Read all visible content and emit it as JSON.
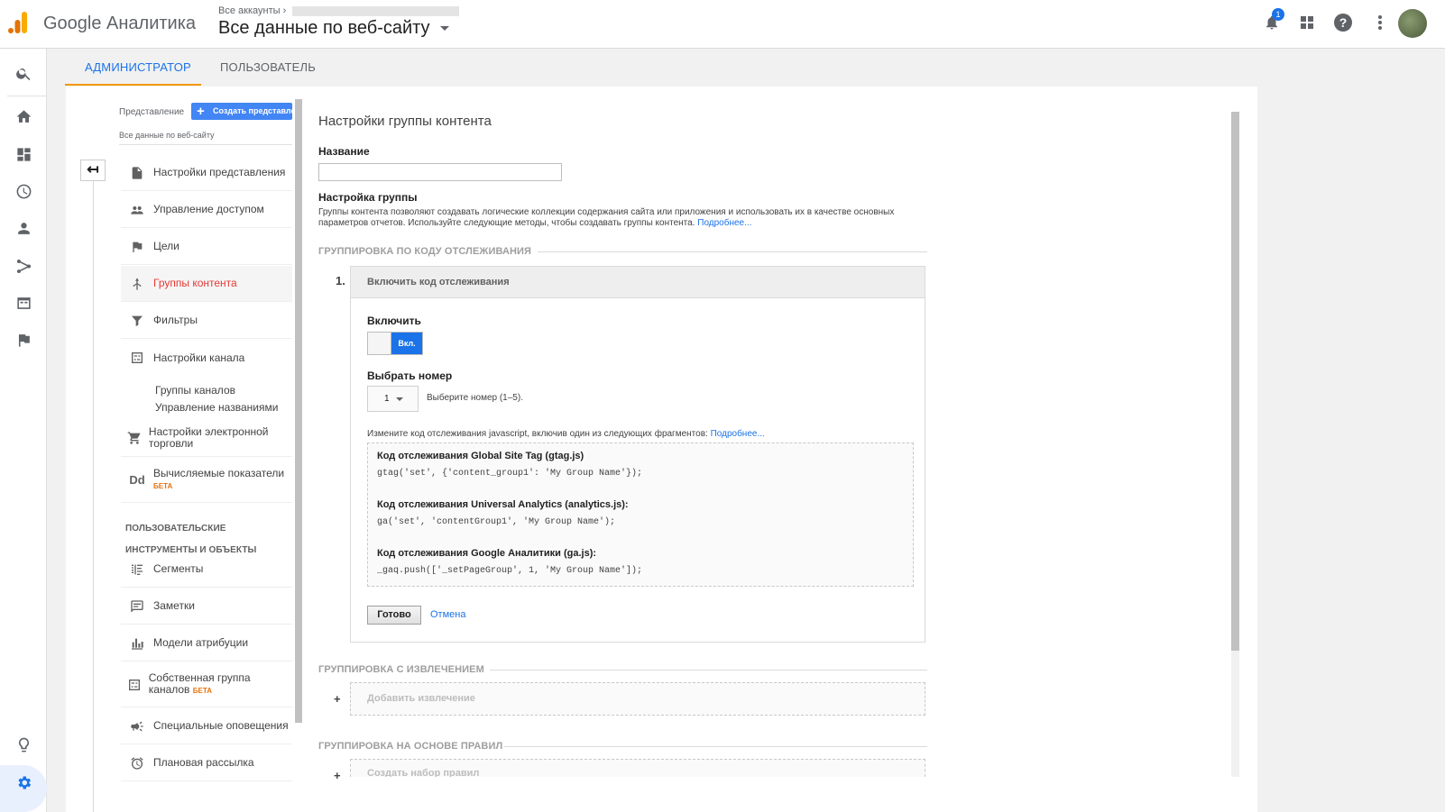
{
  "brand": {
    "name": "Google Аналитика"
  },
  "account": {
    "crumb": "Все аккаунты",
    "view": "Все данные по веб-сайту"
  },
  "notifications": {
    "count": "1"
  },
  "tabs": {
    "admin": "АДМИНИСТРАТОР",
    "user": "ПОЛЬЗОВАТЕЛЬ"
  },
  "view_column": {
    "label": "Представление",
    "create_button": "Создать представление",
    "view_name": "Все данные по веб-сайту",
    "items": [
      {
        "label": "Настройки представления",
        "icon": "document-icon"
      },
      {
        "label": "Управление доступом",
        "icon": "people-icon"
      },
      {
        "label": "Цели",
        "icon": "flag-icon"
      },
      {
        "label": "Группы контента",
        "icon": "content-group-icon"
      },
      {
        "label": "Фильтры",
        "icon": "filter-icon"
      },
      {
        "label": "Настройки канала",
        "icon": "channel-settings-icon"
      }
    ],
    "sub_items": [
      "Группы каналов",
      "Управление названиями"
    ],
    "items2": [
      {
        "label": "Настройки электронной торговли",
        "icon": "cart-icon"
      },
      {
        "label": "Вычисляемые показатели",
        "badge": "БЕТА",
        "icon": "dd-icon"
      }
    ],
    "section_title": "ПОЛЬЗОВАТЕЛЬСКИЕ ИНСТРУМЕНТЫ И ОБЪЕКТЫ",
    "items3": [
      {
        "label": "Сегменты",
        "icon": "segments-icon"
      },
      {
        "label": "Заметки",
        "icon": "notes-icon"
      },
      {
        "label": "Модели атрибуции",
        "icon": "attribution-icon"
      },
      {
        "label": "Собственная группа каналов",
        "badge": "БЕТА",
        "icon": "custom-channel-icon"
      },
      {
        "label": "Специальные оповещения",
        "icon": "megaphone-icon"
      },
      {
        "label": "Плановая рассылка",
        "icon": "alarm-icon"
      }
    ]
  },
  "content": {
    "title": "Настройки группы контента",
    "name_label": "Название",
    "name_value": "",
    "group_setup_label": "Настройка группы",
    "group_setup_desc": "Группы контента позволяют создавать логические коллекции содержания сайта или приложения и использовать их в качестве основных параметров отчетов. Используйте следующие методы, чтобы создавать группы контента.",
    "more_link": "Подробнее...",
    "tracking_section": "ГРУППИРОВКА ПО КОДУ ОТСЛЕЖИВАНИЯ",
    "step": "1.",
    "step_title": "Включить код отслеживания",
    "enable_label": "Включить",
    "toggle_on": "Вкл.",
    "index_label": "Выбрать номер",
    "index_value": "1",
    "index_hint": "Выберите номер (1–5).",
    "code_note": "Измените код отслеживания javascript, включив один из следующих фрагментов:",
    "code_more": "Подробнее...",
    "snippets": [
      {
        "title": "Код отслеживания Global Site Tag (gtag.js)",
        "code": "gtag('set', {'content_group1': 'My Group Name'});"
      },
      {
        "title": "Код отслеживания Universal Analytics (analytics.js):",
        "code": "ga('set', 'contentGroup1', 'My Group Name');"
      },
      {
        "title": "Код отслеживания Google Аналитики (ga.js):",
        "code": "_gaq.push(['_setPageGroup', 1, 'My Group Name']);"
      }
    ],
    "done_button": "Готово",
    "cancel_link": "Отмена",
    "extraction_section": "ГРУППИРОВКА С ИЗВЛЕЧЕНИЕМ",
    "add_extraction": "Добавить извлечение",
    "rules_section": "ГРУППИРОВКА НА ОСНОВЕ ПРАВИЛ",
    "create_ruleset": "Создать набор правил",
    "plus": "+"
  },
  "colors": {
    "accent": "#1a73e8",
    "active_tab_underline": "#f29900",
    "active_nav": "#e53935",
    "beta": "#e8710a"
  }
}
